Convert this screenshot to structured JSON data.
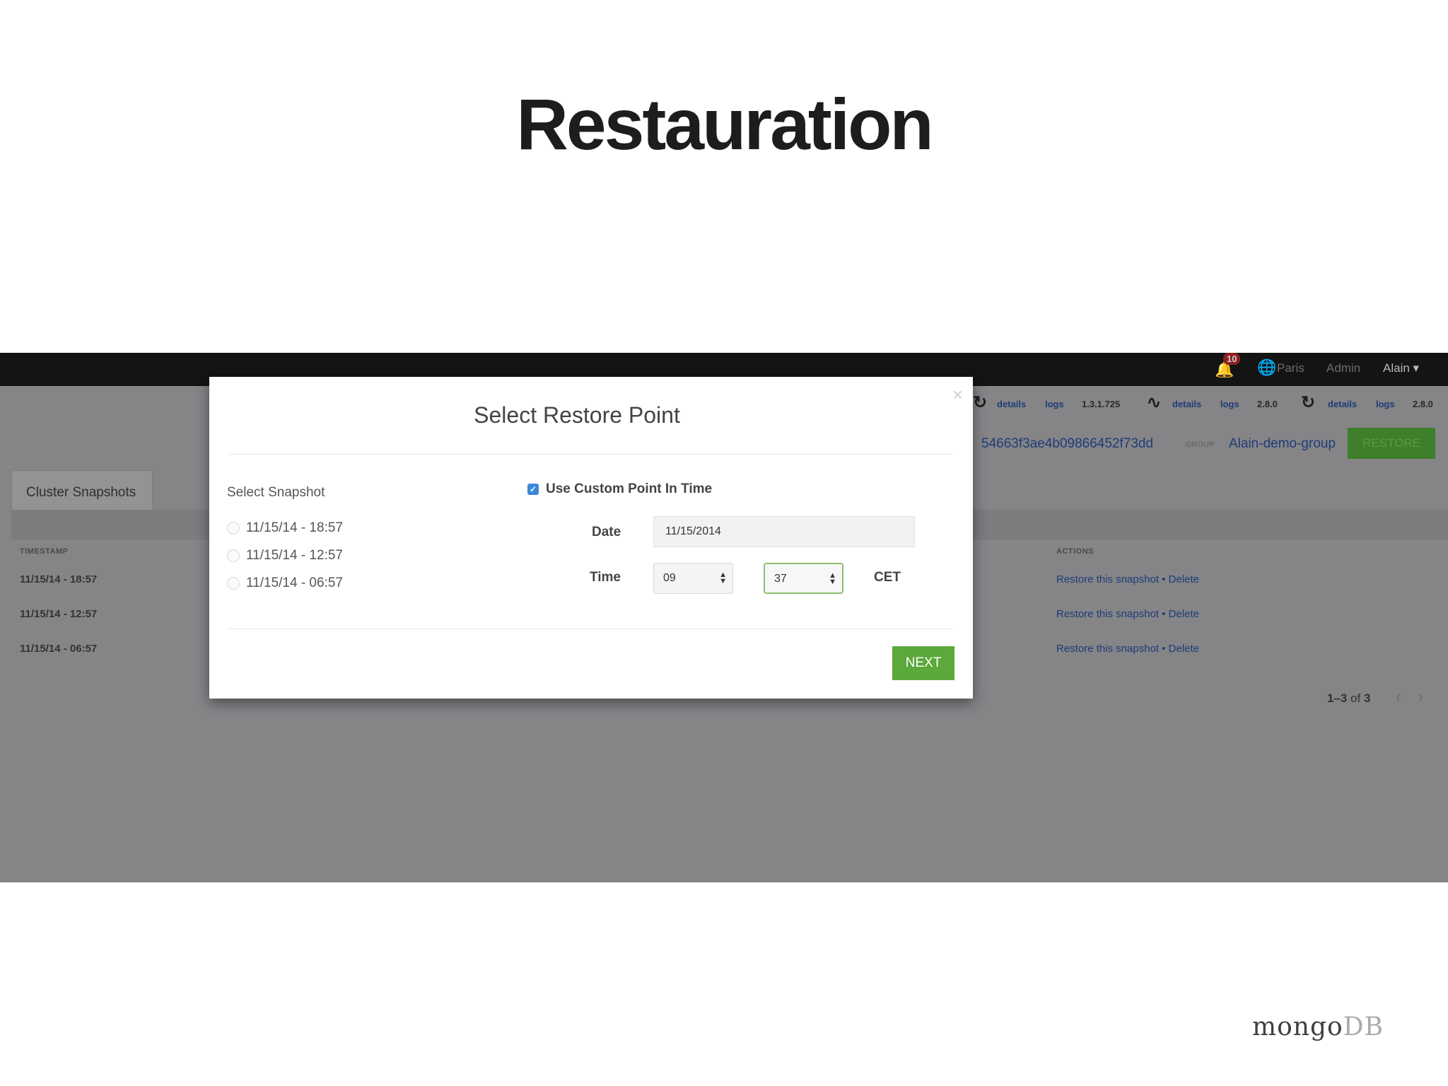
{
  "slide": {
    "title": "Restauration",
    "logo_main": "mongo",
    "logo_suffix": "DB"
  },
  "topbar": {
    "notification_count": "10",
    "items": [
      "Paris",
      "Admin",
      "Alain ▾"
    ]
  },
  "status_bar": [
    {
      "details": "details",
      "logs": "logs",
      "version": "1.3.1.725"
    },
    {
      "details": "details",
      "logs": "logs",
      "version": "2.8.0"
    },
    {
      "details": "details",
      "logs": "logs",
      "version": "2.8.0"
    }
  ],
  "cluster": {
    "id": "54663f3ae4b09866452f73dd",
    "group_label": "GROUP",
    "group_name": "Alain-demo-group",
    "restore_button": "RESTORE"
  },
  "snapshots_panel": {
    "tab_label": "Cluster Snapshots",
    "col_timestamp": "TIMESTAMP",
    "col_actions": "ACTIONS",
    "rows": [
      {
        "timestamp": "11/15/14 - 18:57",
        "actions": "Restore this snapshot • Delete"
      },
      {
        "timestamp": "11/15/14 - 12:57",
        "actions": "Restore this snapshot • Delete"
      },
      {
        "timestamp": "11/15/14 - 06:57",
        "actions": "Restore this snapshot • Delete"
      }
    ],
    "pager": {
      "range": "1–3",
      "of": "of",
      "total": "3"
    }
  },
  "modal": {
    "title": "Select Restore Point",
    "close": "×",
    "select_snapshot_label": "Select Snapshot",
    "snapshots": [
      "11/15/14 - 18:57",
      "11/15/14 - 12:57",
      "11/15/14 - 06:57"
    ],
    "custom_point_label": "Use Custom Point In Time",
    "custom_point_checked": true,
    "date_label": "Date",
    "date_value": "11/15/2014",
    "time_label": "Time",
    "hour_value": "09",
    "minute_value": "37",
    "timezone": "CET",
    "next_button": "NEXT"
  },
  "colors": {
    "accent_green": "#5aa93a",
    "checkbox_blue": "#3b87d9",
    "link_blue": "#1d3d78",
    "overlay_gray": "#858487"
  }
}
